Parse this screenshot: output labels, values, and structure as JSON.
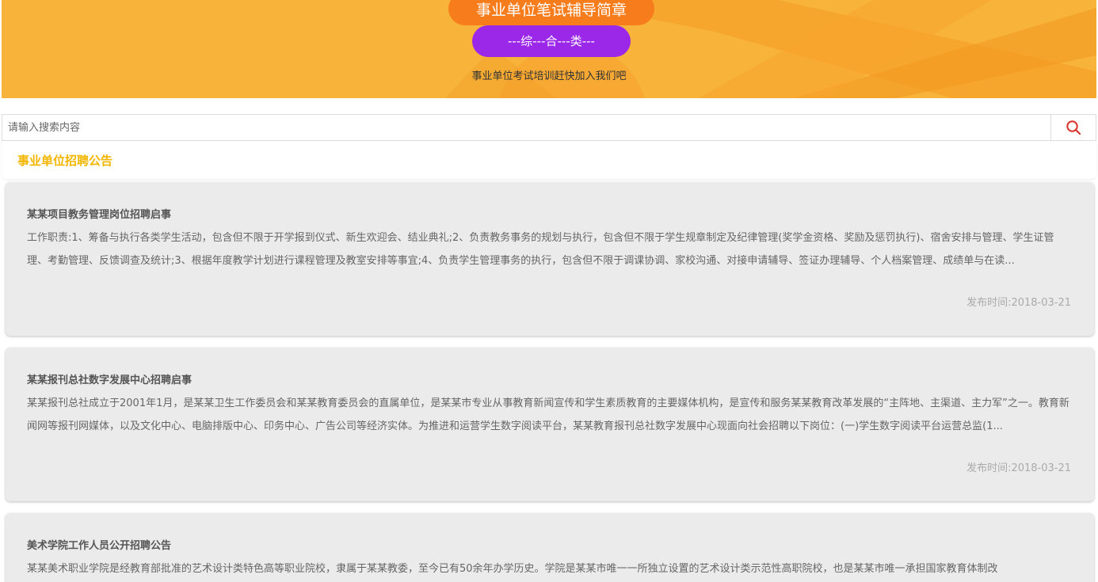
{
  "banner": {
    "title": "事业单位笔试辅导简章",
    "category": "---综---合---类---",
    "slogan": "事业单位考试培训赶快加入我们吧",
    "bg_color": "#f8b33a",
    "title_color": "#f77d1c",
    "category_color": "#9b27e8"
  },
  "search": {
    "placeholder": "请输入搜索内容",
    "icon": "search-icon",
    "icon_color": "#d9342b"
  },
  "section": {
    "title": "事业单位招聘公告",
    "title_color": "#f2b600"
  },
  "articles": [
    {
      "title": "某某项目教务管理岗位招聘启事",
      "summary": "工作职责:1、筹备与执行各类学生活动，包含但不限于开学报到仪式、新生欢迎会、结业典礼;2、负责教务事务的规划与执行，包含但不限于学生规章制定及纪律管理(奖学金资格、奖励及惩罚执行)、宿舍安排与管理、学生证管理、考勤管理、反馈调查及统计;3、根据年度教学计划进行课程管理及教室安排等事宜;4、负责学生管理事务的执行，包含但不限于调课协调、家校沟通、对接申请辅导、签证办理辅导、个人档案管理、成绩单与在读...",
      "date": "发布时间:2018-03-21"
    },
    {
      "title": "某某报刊总社数字发展中心招聘启事",
      "summary": "某某报刊总社成立于2001年1月，是某某卫生工作委员会和某某教育委员会的直属单位，是某某市专业从事教育新闻宣传和学生素质教育的主要媒体机构，是宣传和服务某某教育改革发展的“主阵地、主渠道、主力军”之一。教育新闻网等报刊网媒体，以及文化中心、电脑排版中心、印务中心、广告公司等经济实体。为推进和运营学生数字阅读平台，某某教育报刊总社数字发展中心现面向社会招聘以下岗位：(一)学生数字阅读平台运营总监(1...",
      "date": "发布时间:2018-03-21"
    },
    {
      "title": "美术学院工作人员公开招聘公告",
      "summary": "某某美术职业学院是经教育部批准的艺术设计类特色高等职业院校，隶属于某某教委，至今已有50余年办学历史。学院是某某市唯一一所独立设置的艺术设计类示范性高职院校，也是某某市唯一承担国家教育体制改",
      "date": ""
    }
  ]
}
